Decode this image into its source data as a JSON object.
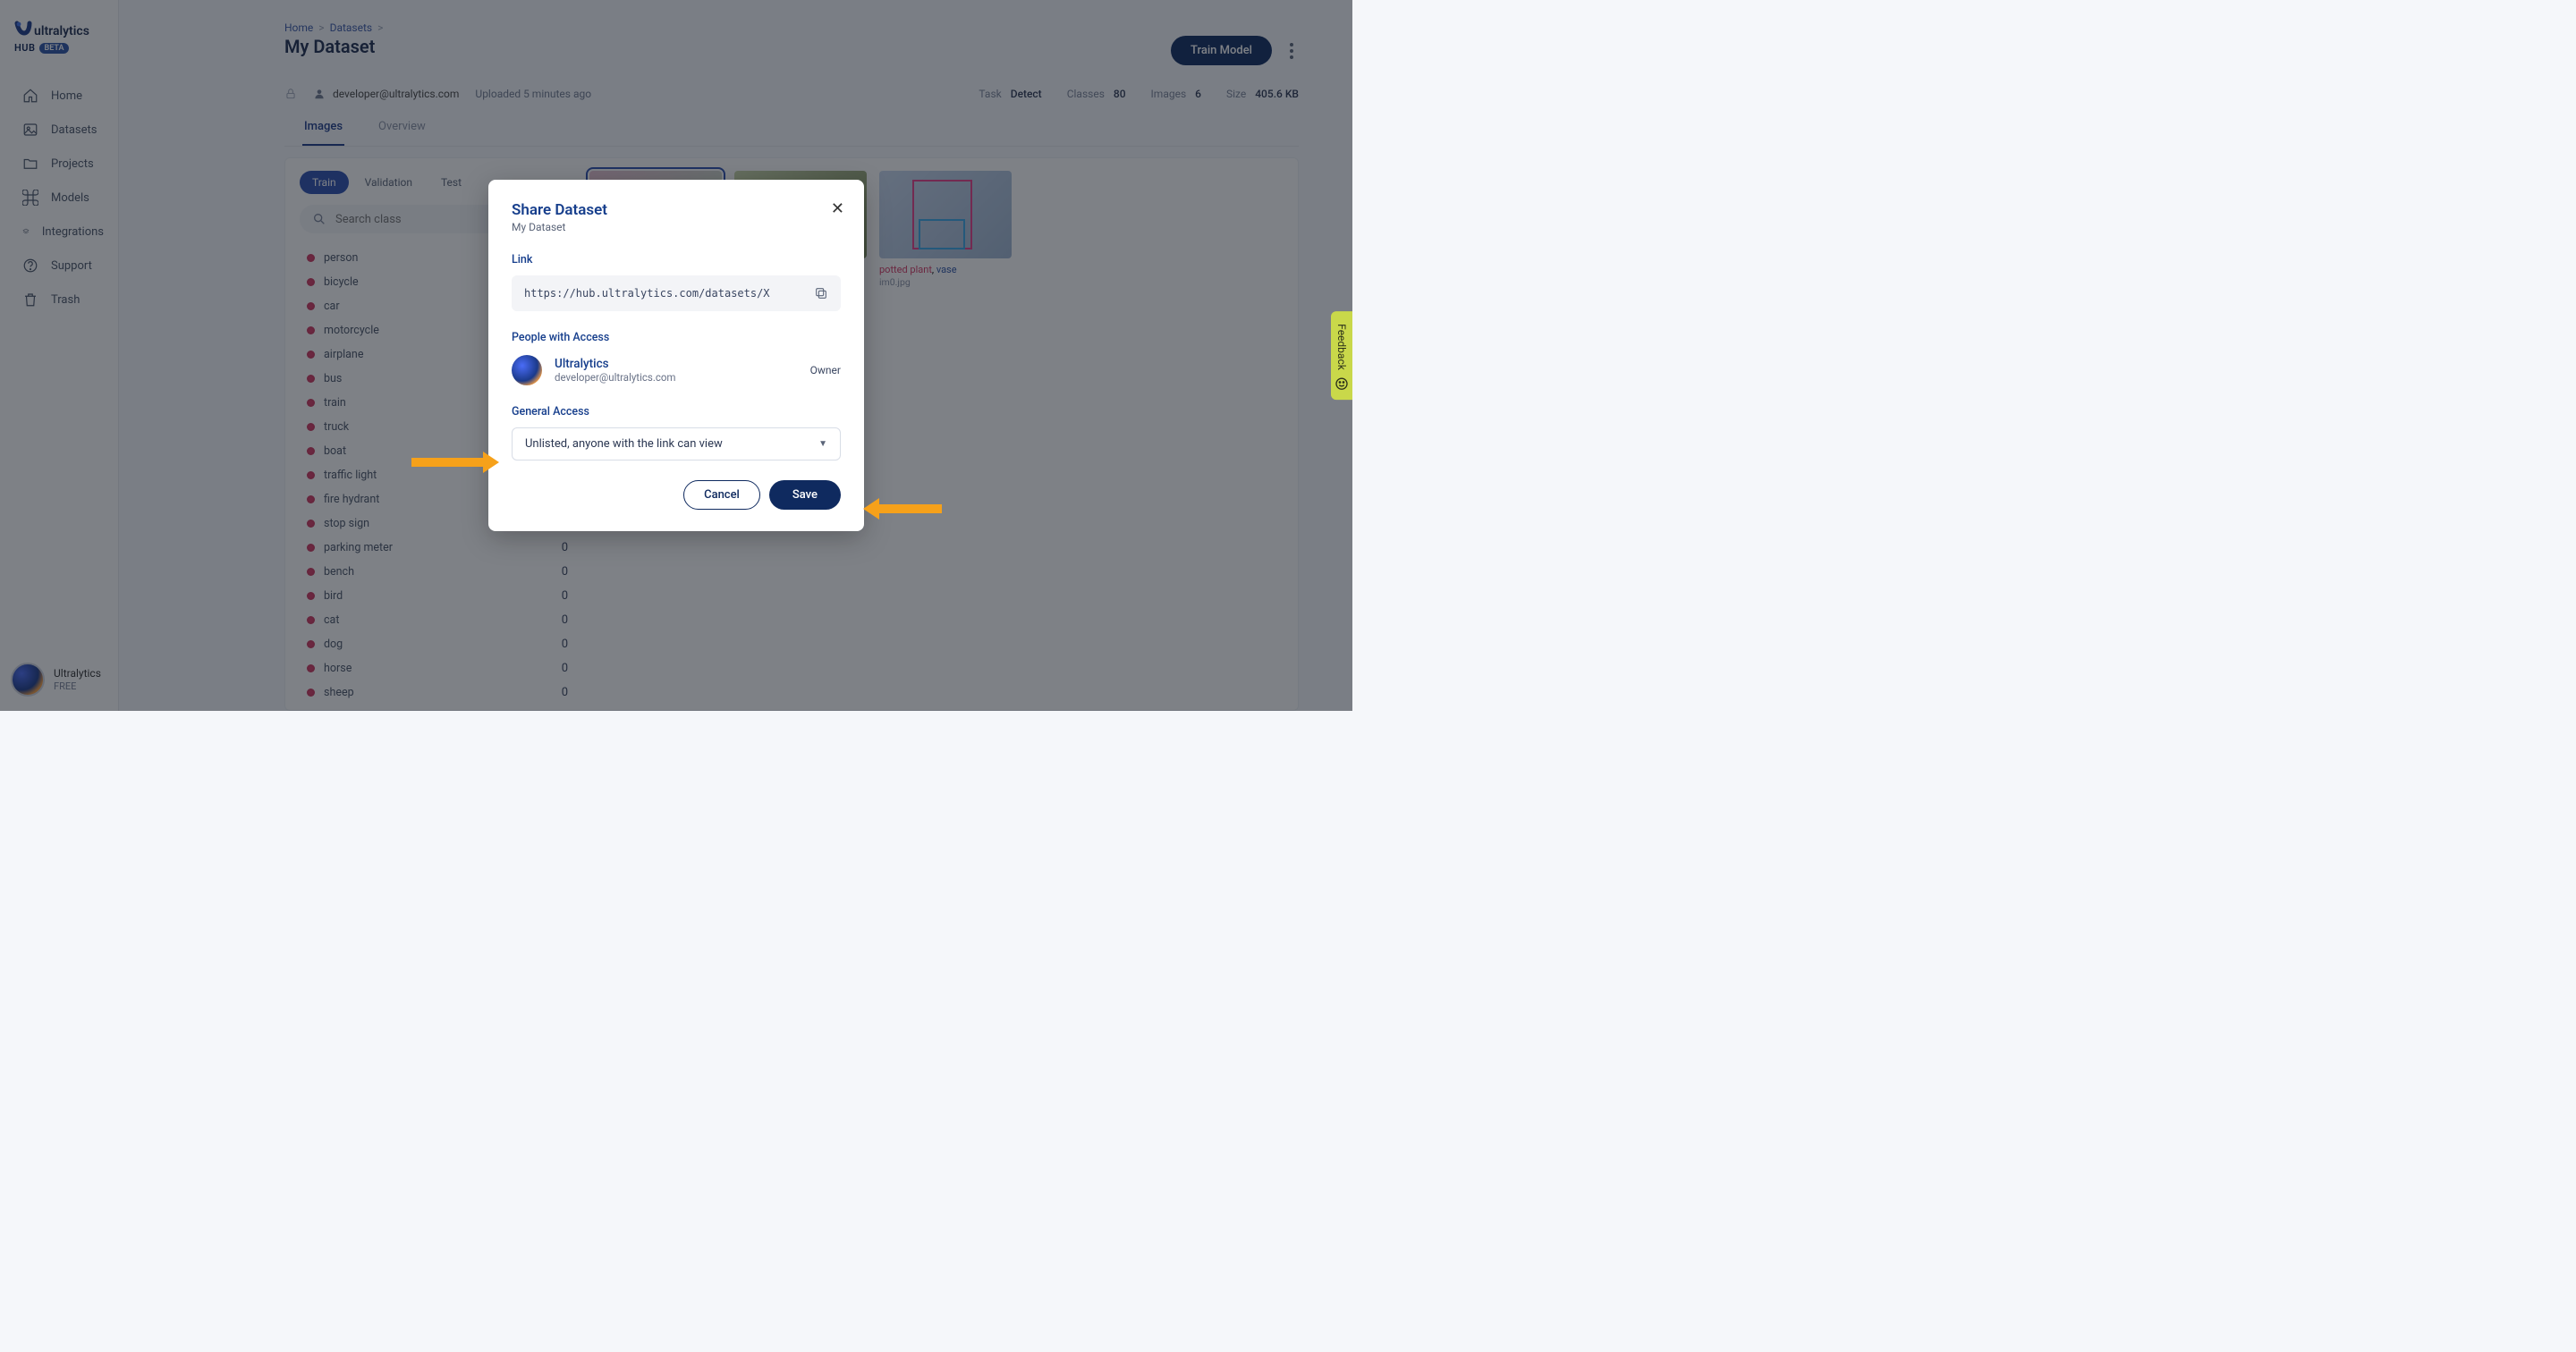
{
  "brand": {
    "name": "ultralytics",
    "hub": "HUB",
    "beta": "BETA"
  },
  "sidebar": {
    "items": [
      {
        "label": "Home"
      },
      {
        "label": "Datasets"
      },
      {
        "label": "Projects"
      },
      {
        "label": "Models"
      },
      {
        "label": "Integrations"
      },
      {
        "label": "Support"
      },
      {
        "label": "Trash"
      }
    ],
    "footer": {
      "name": "Ultralytics",
      "plan": "FREE"
    }
  },
  "breadcrumbs": [
    {
      "label": "Home"
    },
    {
      "label": "Datasets"
    }
  ],
  "page": {
    "title": "My Dataset",
    "train_button": "Train Model"
  },
  "owner_meta": {
    "owner": "developer@ultralytics.com",
    "uploaded": "Uploaded 5 minutes ago"
  },
  "stats": [
    {
      "k": "Task",
      "v": "Detect"
    },
    {
      "k": "Classes",
      "v": "80"
    },
    {
      "k": "Images",
      "v": "6"
    },
    {
      "k": "Size",
      "v": "405.6 KB"
    }
  ],
  "tabs_top": [
    {
      "label": "Images",
      "active": true
    },
    {
      "label": "Overview",
      "active": false
    }
  ],
  "split_tabs": [
    {
      "label": "Train",
      "active": true
    },
    {
      "label": "Validation",
      "active": false
    },
    {
      "label": "Test",
      "active": false
    }
  ],
  "search": {
    "placeholder": "Search class"
  },
  "classes": [
    {
      "name": "person"
    },
    {
      "name": "bicycle"
    },
    {
      "name": "car"
    },
    {
      "name": "motorcycle"
    },
    {
      "name": "airplane"
    },
    {
      "name": "bus"
    },
    {
      "name": "train"
    },
    {
      "name": "truck"
    },
    {
      "name": "boat"
    },
    {
      "name": "traffic light"
    },
    {
      "name": "fire hydrant"
    },
    {
      "name": "stop sign"
    },
    {
      "name": "parking meter",
      "count": "0"
    },
    {
      "name": "bench",
      "count": "0"
    },
    {
      "name": "bird",
      "count": "0"
    },
    {
      "name": "cat",
      "count": "0"
    },
    {
      "name": "dog",
      "count": "0"
    },
    {
      "name": "horse",
      "count": "0"
    },
    {
      "name": "sheep",
      "count": "0"
    }
  ],
  "thumbs": [
    {
      "active": true
    },
    {
      "active": false
    },
    {
      "active": false,
      "tags": {
        "a": "potted plant",
        "sep": ", ",
        "b": "vase"
      },
      "file": "im0.jpg"
    }
  ],
  "modal": {
    "title": "Share Dataset",
    "subtitle": "My Dataset",
    "link_label": "Link",
    "link_value": "https://hub.ultralytics.com/datasets/X",
    "access_label": "People with Access",
    "org_name": "Ultralytics",
    "org_email": "developer@ultralytics.com",
    "role": "Owner",
    "general_access_label": "General Access",
    "access_select": "Unlisted, anyone with the link can view",
    "cancel": "Cancel",
    "save": "Save"
  },
  "feedback": "Feedback"
}
